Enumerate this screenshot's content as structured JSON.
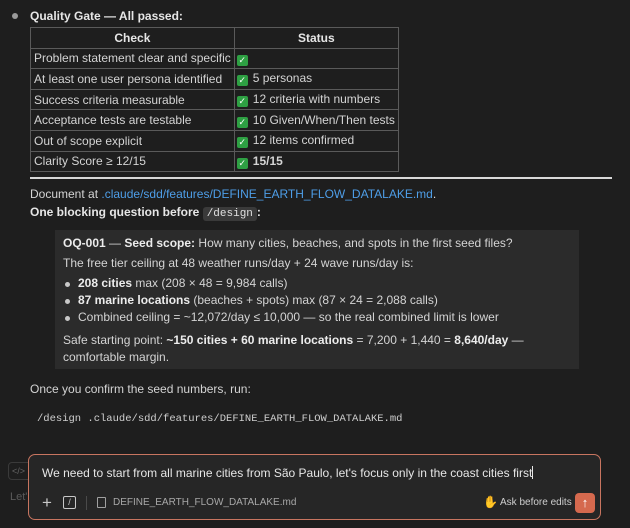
{
  "quality_gate": {
    "title": "Quality Gate — All passed:",
    "headers": [
      "Check",
      "Status"
    ],
    "rows": [
      {
        "check": "Problem statement clear and specific",
        "status": "",
        "bold": false
      },
      {
        "check": "At least one user persona identified",
        "status": "5 personas",
        "bold": false
      },
      {
        "check": "Success criteria measurable",
        "status": "12 criteria with numbers",
        "bold": false
      },
      {
        "check": "Acceptance tests are testable",
        "status": "10 Given/When/Then tests",
        "bold": false
      },
      {
        "check": "Out of scope explicit",
        "status": "12 items confirmed",
        "bold": false
      },
      {
        "check": "Clarity Score ≥ 12/15",
        "status": "15/15",
        "bold": true
      }
    ]
  },
  "document": {
    "prefix": "Document at ",
    "link": ".claude/sdd/features/DEFINE_EARTH_FLOW_DATALAKE.md",
    "suffix": "."
  },
  "blocking": {
    "text": "One blocking question before ",
    "code": "/design",
    "suffix": ":"
  },
  "question": {
    "id": "OQ-001",
    "dash": " — ",
    "topic": "Seed scope:",
    "text": " How many cities, beaches, and spots in the first seed files?",
    "intro": "The free tier ceiling at 48 weather runs/day + 24 wave runs/day is:",
    "bullets": [
      {
        "bold": "208 cities",
        "rest": " max (208 × 48 = 9,984 calls)"
      },
      {
        "bold": "87 marine locations",
        "rest": " (beaches + spots) max (87 × 24 = 2,088 calls)"
      },
      {
        "bold": "",
        "rest": "Combined ceiling = ~12,072/day ≤ 10,000 — so the real combined limit is lower"
      }
    ],
    "safe_prefix": "Safe starting point: ",
    "safe_bold1": "~150 cities + 60 marine locations",
    "safe_mid": " = 7,200 + 1,440 = ",
    "safe_bold2": "8,640/day",
    "safe_suffix": " — comfortable margin."
  },
  "confirm_text": "Once you confirm the seed numbers, run:",
  "command": "/design .claude/sdd/features/DEFINE_EARTH_FLOW_DATALAKE.md",
  "input": {
    "value": "We need to start from all marine cities from São Paulo, let's focus only in the coast cities first",
    "attachment": "DEFINE_EARTH_FLOW_DATALAKE.md",
    "mode_label": "Ask before edits",
    "slash_icon": "/",
    "plus_icon": "+",
    "ghost_label": "Let'"
  },
  "colors": {
    "accent": "#d5694e",
    "link": "#4e9ee8",
    "check": "#2ea043"
  }
}
